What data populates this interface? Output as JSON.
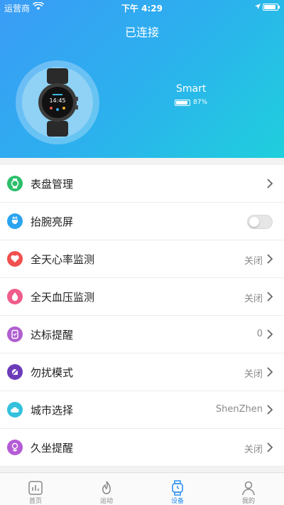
{
  "statusbar": {
    "carrier": "运营商",
    "time": "下午 4:29"
  },
  "header": {
    "status": "已连接",
    "device_name": "Smart",
    "battery_percent": "87%",
    "battery_level": 0.87
  },
  "settings": [
    {
      "label": "表盘管理",
      "value": "",
      "control": "chevron",
      "icon": "watch-face-icon",
      "color": "#2cbf6b"
    },
    {
      "label": "抬腕亮屏",
      "value": "",
      "control": "toggle",
      "toggle_on": false,
      "icon": "raise-wrist-icon",
      "color": "#2aa4f0"
    },
    {
      "label": "全天心率监测",
      "value": "关闭",
      "control": "chevron",
      "icon": "heart-icon",
      "color": "#f0504f"
    },
    {
      "label": "全天血压监测",
      "value": "关闭",
      "control": "chevron",
      "icon": "blood-drop-icon",
      "color": "#f05c8a"
    },
    {
      "label": "达标提醒",
      "value": "0",
      "control": "chevron",
      "icon": "goal-icon",
      "color": "#b05fd0"
    },
    {
      "label": "勿扰模式",
      "value": "关闭",
      "control": "chevron",
      "icon": "do-not-disturb-icon",
      "color": "#6b3bb8"
    },
    {
      "label": "城市选择",
      "value": "ShenZhen",
      "control": "chevron",
      "icon": "cloud-icon",
      "color": "#34c1dc"
    },
    {
      "label": "久坐提醒",
      "value": "关闭",
      "control": "chevron",
      "icon": "sedentary-icon",
      "color": "#b55bd6"
    }
  ],
  "tabs": [
    {
      "label": "首页",
      "icon": "chart-icon",
      "active": false
    },
    {
      "label": "运动",
      "icon": "flame-icon",
      "active": false
    },
    {
      "label": "设备",
      "icon": "watch-icon",
      "active": true
    },
    {
      "label": "我的",
      "icon": "person-icon",
      "active": false
    }
  ],
  "colors": {
    "accent": "#2a8ff7",
    "header_start": "#3a9cf6",
    "header_end": "#1fcfdc"
  }
}
